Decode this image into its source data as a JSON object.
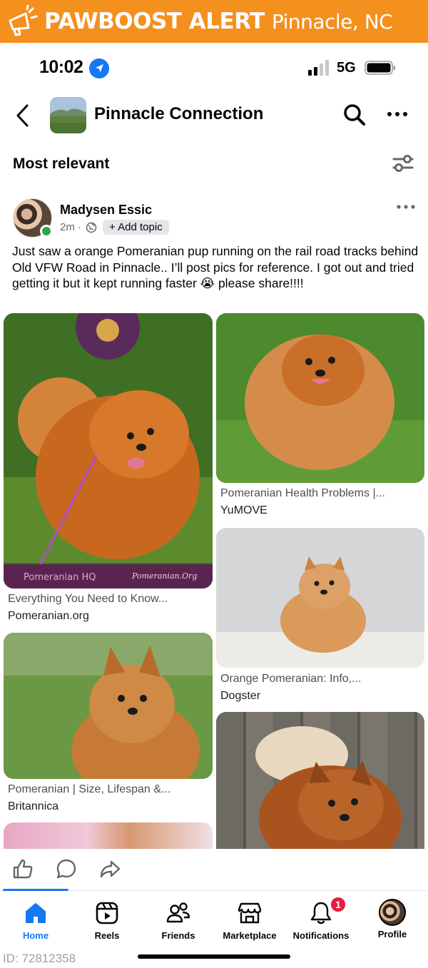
{
  "alert": {
    "brand": "PAWBOOST ALERT",
    "location": "Pinnacle, NC",
    "bg_color": "#f4901e"
  },
  "status_bar": {
    "time": "10:02",
    "network": "5G"
  },
  "group": {
    "name": "Pinnacle Connection"
  },
  "sort": {
    "label": "Most relevant"
  },
  "post": {
    "author": "Madysen Essic",
    "time": "2m",
    "add_topic": "+ Add topic",
    "text": "Just saw a orange Pomeranian pup running on the rail road tracks behind Old VFW Road in Pinnacle.. I’ll post pics for reference. I got out and tried getting it but it kept running faster 😭 please share!!!!"
  },
  "images": [
    {
      "title": "Everything You Need to Know...",
      "source": "Pomeranian.org",
      "overlay_left": "Pomeranian HQ",
      "overlay_right": "Pomeranian.Org"
    },
    {
      "title": "Pomeranian Health Problems |...",
      "source": "YuMOVE"
    },
    {
      "title": "Orange Pomeranian: Info,...",
      "source": "Dogster"
    },
    {
      "title": "Pomeranian | Size, Lifespan &...",
      "source": "Britannica"
    }
  ],
  "bottom_nav": [
    {
      "label": "Home",
      "icon": "home-icon",
      "active": true
    },
    {
      "label": "Reels",
      "icon": "reels-icon"
    },
    {
      "label": "Friends",
      "icon": "friends-icon"
    },
    {
      "label": "Marketplace",
      "icon": "marketplace-icon"
    },
    {
      "label": "Notifications",
      "icon": "bell-icon",
      "badge": "1"
    },
    {
      "label": "Profile",
      "icon": "profile-avatar"
    }
  ],
  "footer_id": "ID: 72812358",
  "colors": {
    "accent": "#1877f2",
    "badge": "#e41e3f",
    "online": "#31a24c"
  }
}
